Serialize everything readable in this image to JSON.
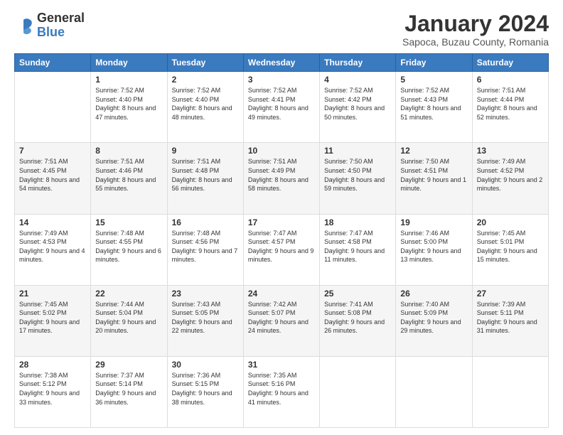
{
  "header": {
    "logo_general": "General",
    "logo_blue": "Blue",
    "month_title": "January 2024",
    "location": "Sapoca, Buzau County, Romania"
  },
  "weekdays": [
    "Sunday",
    "Monday",
    "Tuesday",
    "Wednesday",
    "Thursday",
    "Friday",
    "Saturday"
  ],
  "weeks": [
    [
      {
        "day": "",
        "sunrise": "",
        "sunset": "",
        "daylight": ""
      },
      {
        "day": "1",
        "sunrise": "Sunrise: 7:52 AM",
        "sunset": "Sunset: 4:40 PM",
        "daylight": "Daylight: 8 hours and 47 minutes."
      },
      {
        "day": "2",
        "sunrise": "Sunrise: 7:52 AM",
        "sunset": "Sunset: 4:40 PM",
        "daylight": "Daylight: 8 hours and 48 minutes."
      },
      {
        "day": "3",
        "sunrise": "Sunrise: 7:52 AM",
        "sunset": "Sunset: 4:41 PM",
        "daylight": "Daylight: 8 hours and 49 minutes."
      },
      {
        "day": "4",
        "sunrise": "Sunrise: 7:52 AM",
        "sunset": "Sunset: 4:42 PM",
        "daylight": "Daylight: 8 hours and 50 minutes."
      },
      {
        "day": "5",
        "sunrise": "Sunrise: 7:52 AM",
        "sunset": "Sunset: 4:43 PM",
        "daylight": "Daylight: 8 hours and 51 minutes."
      },
      {
        "day": "6",
        "sunrise": "Sunrise: 7:51 AM",
        "sunset": "Sunset: 4:44 PM",
        "daylight": "Daylight: 8 hours and 52 minutes."
      }
    ],
    [
      {
        "day": "7",
        "sunrise": "Sunrise: 7:51 AM",
        "sunset": "Sunset: 4:45 PM",
        "daylight": "Daylight: 8 hours and 54 minutes."
      },
      {
        "day": "8",
        "sunrise": "Sunrise: 7:51 AM",
        "sunset": "Sunset: 4:46 PM",
        "daylight": "Daylight: 8 hours and 55 minutes."
      },
      {
        "day": "9",
        "sunrise": "Sunrise: 7:51 AM",
        "sunset": "Sunset: 4:48 PM",
        "daylight": "Daylight: 8 hours and 56 minutes."
      },
      {
        "day": "10",
        "sunrise": "Sunrise: 7:51 AM",
        "sunset": "Sunset: 4:49 PM",
        "daylight": "Daylight: 8 hours and 58 minutes."
      },
      {
        "day": "11",
        "sunrise": "Sunrise: 7:50 AM",
        "sunset": "Sunset: 4:50 PM",
        "daylight": "Daylight: 8 hours and 59 minutes."
      },
      {
        "day": "12",
        "sunrise": "Sunrise: 7:50 AM",
        "sunset": "Sunset: 4:51 PM",
        "daylight": "Daylight: 9 hours and 1 minute."
      },
      {
        "day": "13",
        "sunrise": "Sunrise: 7:49 AM",
        "sunset": "Sunset: 4:52 PM",
        "daylight": "Daylight: 9 hours and 2 minutes."
      }
    ],
    [
      {
        "day": "14",
        "sunrise": "Sunrise: 7:49 AM",
        "sunset": "Sunset: 4:53 PM",
        "daylight": "Daylight: 9 hours and 4 minutes."
      },
      {
        "day": "15",
        "sunrise": "Sunrise: 7:48 AM",
        "sunset": "Sunset: 4:55 PM",
        "daylight": "Daylight: 9 hours and 6 minutes."
      },
      {
        "day": "16",
        "sunrise": "Sunrise: 7:48 AM",
        "sunset": "Sunset: 4:56 PM",
        "daylight": "Daylight: 9 hours and 7 minutes."
      },
      {
        "day": "17",
        "sunrise": "Sunrise: 7:47 AM",
        "sunset": "Sunset: 4:57 PM",
        "daylight": "Daylight: 9 hours and 9 minutes."
      },
      {
        "day": "18",
        "sunrise": "Sunrise: 7:47 AM",
        "sunset": "Sunset: 4:58 PM",
        "daylight": "Daylight: 9 hours and 11 minutes."
      },
      {
        "day": "19",
        "sunrise": "Sunrise: 7:46 AM",
        "sunset": "Sunset: 5:00 PM",
        "daylight": "Daylight: 9 hours and 13 minutes."
      },
      {
        "day": "20",
        "sunrise": "Sunrise: 7:45 AM",
        "sunset": "Sunset: 5:01 PM",
        "daylight": "Daylight: 9 hours and 15 minutes."
      }
    ],
    [
      {
        "day": "21",
        "sunrise": "Sunrise: 7:45 AM",
        "sunset": "Sunset: 5:02 PM",
        "daylight": "Daylight: 9 hours and 17 minutes."
      },
      {
        "day": "22",
        "sunrise": "Sunrise: 7:44 AM",
        "sunset": "Sunset: 5:04 PM",
        "daylight": "Daylight: 9 hours and 20 minutes."
      },
      {
        "day": "23",
        "sunrise": "Sunrise: 7:43 AM",
        "sunset": "Sunset: 5:05 PM",
        "daylight": "Daylight: 9 hours and 22 minutes."
      },
      {
        "day": "24",
        "sunrise": "Sunrise: 7:42 AM",
        "sunset": "Sunset: 5:07 PM",
        "daylight": "Daylight: 9 hours and 24 minutes."
      },
      {
        "day": "25",
        "sunrise": "Sunrise: 7:41 AM",
        "sunset": "Sunset: 5:08 PM",
        "daylight": "Daylight: 9 hours and 26 minutes."
      },
      {
        "day": "26",
        "sunrise": "Sunrise: 7:40 AM",
        "sunset": "Sunset: 5:09 PM",
        "daylight": "Daylight: 9 hours and 29 minutes."
      },
      {
        "day": "27",
        "sunrise": "Sunrise: 7:39 AM",
        "sunset": "Sunset: 5:11 PM",
        "daylight": "Daylight: 9 hours and 31 minutes."
      }
    ],
    [
      {
        "day": "28",
        "sunrise": "Sunrise: 7:38 AM",
        "sunset": "Sunset: 5:12 PM",
        "daylight": "Daylight: 9 hours and 33 minutes."
      },
      {
        "day": "29",
        "sunrise": "Sunrise: 7:37 AM",
        "sunset": "Sunset: 5:14 PM",
        "daylight": "Daylight: 9 hours and 36 minutes."
      },
      {
        "day": "30",
        "sunrise": "Sunrise: 7:36 AM",
        "sunset": "Sunset: 5:15 PM",
        "daylight": "Daylight: 9 hours and 38 minutes."
      },
      {
        "day": "31",
        "sunrise": "Sunrise: 7:35 AM",
        "sunset": "Sunset: 5:16 PM",
        "daylight": "Daylight: 9 hours and 41 minutes."
      },
      {
        "day": "",
        "sunrise": "",
        "sunset": "",
        "daylight": ""
      },
      {
        "day": "",
        "sunrise": "",
        "sunset": "",
        "daylight": ""
      },
      {
        "day": "",
        "sunrise": "",
        "sunset": "",
        "daylight": ""
      }
    ]
  ]
}
